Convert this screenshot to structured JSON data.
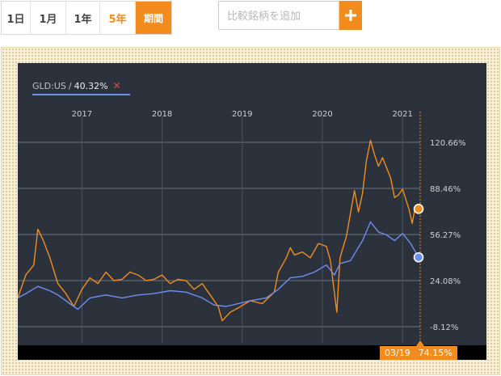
{
  "range_buttons": [
    {
      "label": "1日"
    },
    {
      "label": "1月"
    },
    {
      "label": "1年"
    },
    {
      "label": "5年"
    },
    {
      "label": "期間"
    }
  ],
  "compare": {
    "placeholder": "比較銘柄を追加",
    "add_icon": "plus-icon"
  },
  "legend": {
    "ticker": "GLD:US",
    "separator": "/",
    "value": "40.32%",
    "remove_icon": "close-icon"
  },
  "footer": {
    "date": "03/19",
    "value": "74.15%"
  },
  "colors": {
    "accent": "#f28c1e",
    "series_orange": "#f28c1e",
    "series_blue": "#6e8ef0",
    "background": "#2b323c"
  },
  "chart_data": {
    "type": "line",
    "x_ticks": [
      "2017",
      "2018",
      "2019",
      "2020",
      "2021"
    ],
    "y_ticks": [
      "120.66%",
      "88.46%",
      "56.27%",
      "24.08%",
      "-8.12%"
    ],
    "ylim": [
      -8.12,
      120.66
    ],
    "grid": true,
    "legend_position": "top-left",
    "x_range": [
      2016.2,
      2021.22
    ],
    "series": [
      {
        "name": "",
        "color": "#f28c1e",
        "points": [
          [
            2016.2,
            12
          ],
          [
            2016.3,
            28
          ],
          [
            2016.4,
            35
          ],
          [
            2016.45,
            60
          ],
          [
            2016.52,
            52
          ],
          [
            2016.6,
            40
          ],
          [
            2016.7,
            22
          ],
          [
            2016.8,
            15
          ],
          [
            2016.9,
            6
          ],
          [
            2017.0,
            18
          ],
          [
            2017.1,
            26
          ],
          [
            2017.2,
            22
          ],
          [
            2017.3,
            30
          ],
          [
            2017.4,
            24
          ],
          [
            2017.5,
            25
          ],
          [
            2017.6,
            30
          ],
          [
            2017.7,
            28
          ],
          [
            2017.8,
            24
          ],
          [
            2017.9,
            25
          ],
          [
            2018.0,
            28
          ],
          [
            2018.1,
            22
          ],
          [
            2018.2,
            25
          ],
          [
            2018.3,
            24
          ],
          [
            2018.4,
            18
          ],
          [
            2018.5,
            22
          ],
          [
            2018.6,
            14
          ],
          [
            2018.7,
            6
          ],
          [
            2018.75,
            -4
          ],
          [
            2018.85,
            2
          ],
          [
            2018.95,
            5
          ],
          [
            2019.1,
            10
          ],
          [
            2019.25,
            8
          ],
          [
            2019.4,
            16
          ],
          [
            2019.45,
            30
          ],
          [
            2019.55,
            40
          ],
          [
            2019.6,
            47
          ],
          [
            2019.65,
            42
          ],
          [
            2019.75,
            44
          ],
          [
            2019.85,
            40
          ],
          [
            2019.95,
            50
          ],
          [
            2020.05,
            48
          ],
          [
            2020.1,
            38
          ],
          [
            2020.18,
            2
          ],
          [
            2020.22,
            40
          ],
          [
            2020.3,
            55
          ],
          [
            2020.4,
            87
          ],
          [
            2020.45,
            72
          ],
          [
            2020.5,
            85
          ],
          [
            2020.55,
            108
          ],
          [
            2020.6,
            122
          ],
          [
            2020.65,
            112
          ],
          [
            2020.7,
            104
          ],
          [
            2020.75,
            110
          ],
          [
            2020.85,
            96
          ],
          [
            2020.9,
            82
          ],
          [
            2020.95,
            84
          ],
          [
            2021.0,
            88
          ],
          [
            2021.08,
            74
          ],
          [
            2021.12,
            64
          ],
          [
            2021.16,
            76
          ],
          [
            2021.2,
            74.15
          ]
        ]
      },
      {
        "name": "GLD:US",
        "color": "#6e8ef0",
        "points": [
          [
            2016.2,
            12
          ],
          [
            2016.3,
            15
          ],
          [
            2016.45,
            20
          ],
          [
            2016.6,
            17
          ],
          [
            2016.7,
            14
          ],
          [
            2016.85,
            8
          ],
          [
            2016.95,
            4
          ],
          [
            2017.1,
            12
          ],
          [
            2017.3,
            14
          ],
          [
            2017.5,
            12
          ],
          [
            2017.7,
            14
          ],
          [
            2017.9,
            15
          ],
          [
            2018.1,
            17
          ],
          [
            2018.3,
            16
          ],
          [
            2018.5,
            12
          ],
          [
            2018.65,
            7
          ],
          [
            2018.8,
            6
          ],
          [
            2018.95,
            8
          ],
          [
            2019.1,
            10
          ],
          [
            2019.3,
            12
          ],
          [
            2019.45,
            18
          ],
          [
            2019.6,
            26
          ],
          [
            2019.75,
            27
          ],
          [
            2019.9,
            30
          ],
          [
            2020.05,
            35
          ],
          [
            2020.15,
            28
          ],
          [
            2020.22,
            36
          ],
          [
            2020.35,
            38
          ],
          [
            2020.5,
            52
          ],
          [
            2020.6,
            65
          ],
          [
            2020.7,
            58
          ],
          [
            2020.8,
            56
          ],
          [
            2020.9,
            52
          ],
          [
            2021.0,
            57
          ],
          [
            2021.1,
            50
          ],
          [
            2021.2,
            40.32
          ]
        ]
      }
    ]
  }
}
